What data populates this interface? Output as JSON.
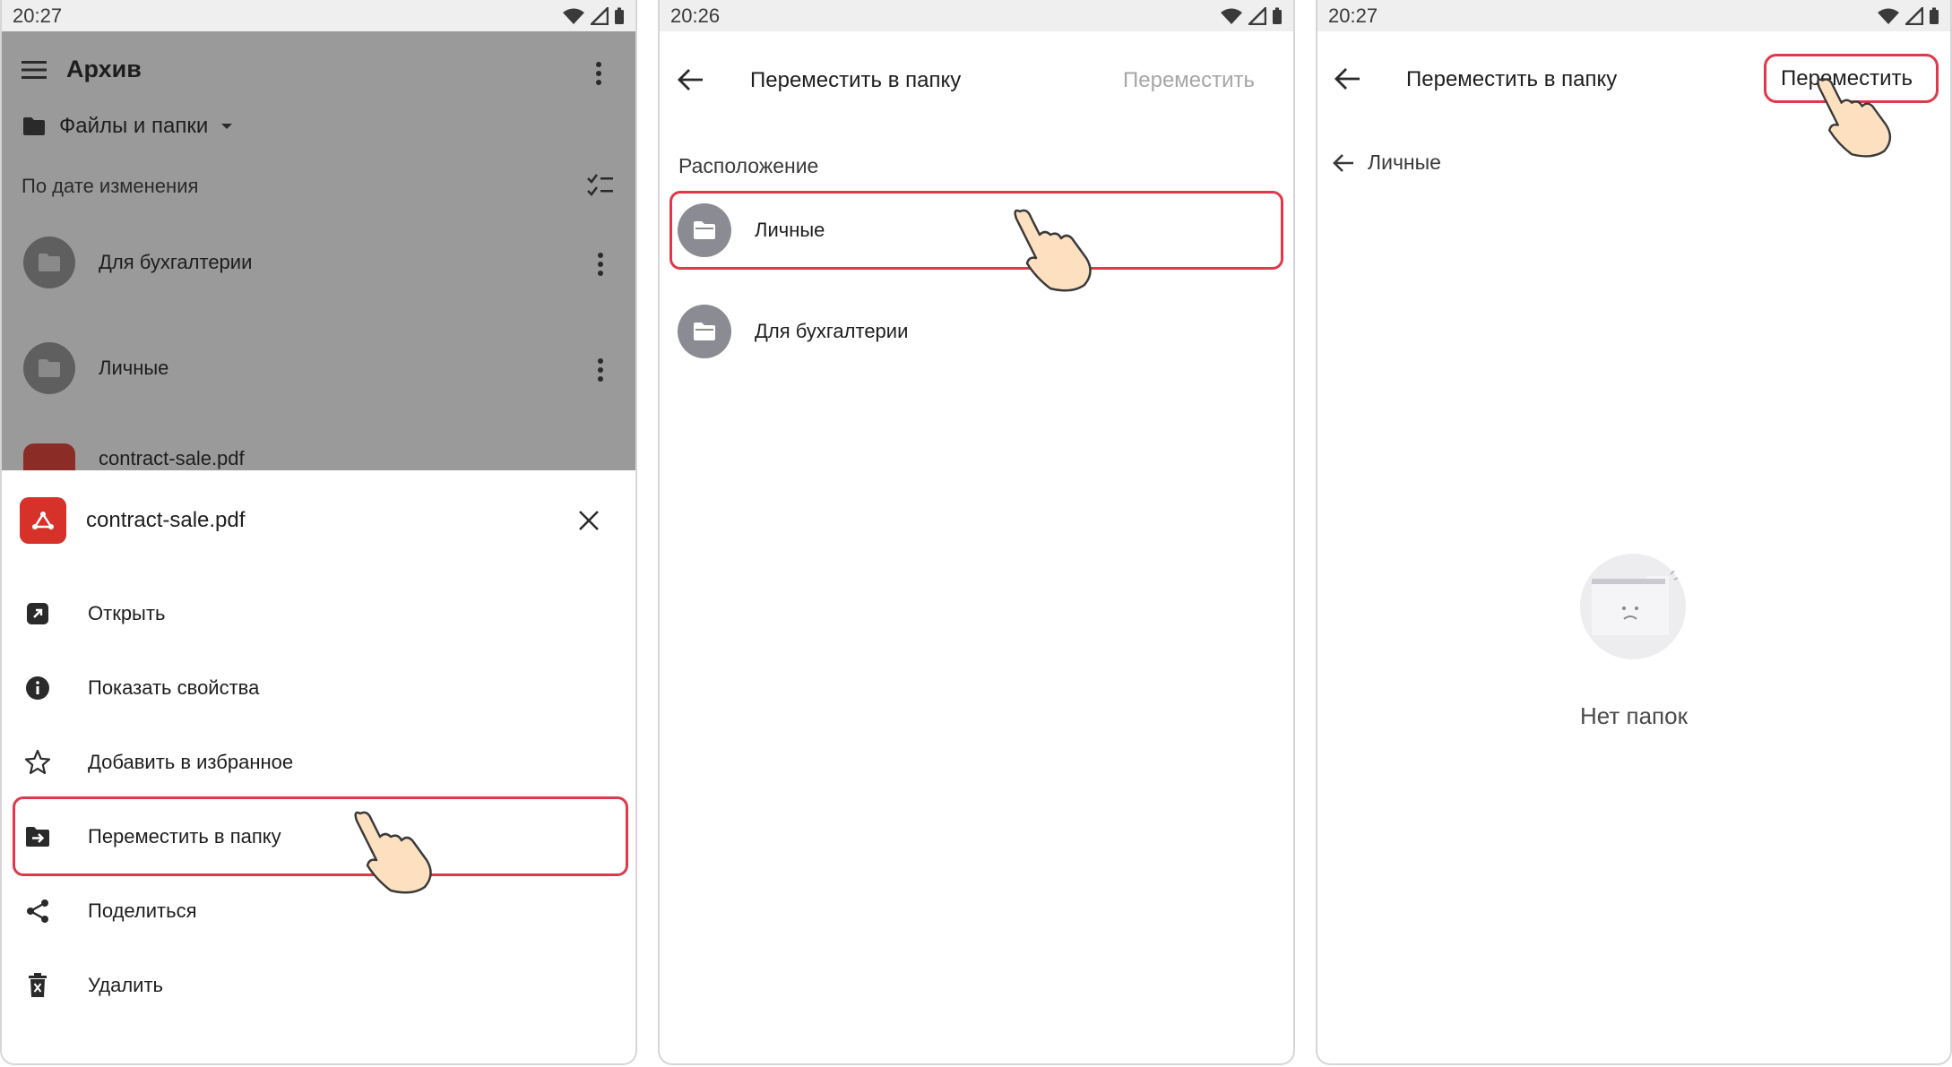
{
  "panel1": {
    "time": "20:27",
    "title": "Архив",
    "files_label": "Файлы и папки",
    "sort_label": "По дате изменения",
    "list": [
      {
        "label": "Для бухгалтерии"
      },
      {
        "label": "Личные"
      },
      {
        "label": "contract-sale.pdf"
      }
    ],
    "sheet": {
      "filename": "contract-sale.pdf",
      "items": [
        {
          "icon": "open-external-icon",
          "label": "Открыть"
        },
        {
          "icon": "info-icon",
          "label": "Показать свойства"
        },
        {
          "icon": "star-icon",
          "label": "Добавить в избранное"
        },
        {
          "icon": "move-to-folder-icon",
          "label": "Переместить в папку"
        },
        {
          "icon": "share-icon",
          "label": "Поделиться"
        },
        {
          "icon": "trash-icon",
          "label": "Удалить"
        }
      ]
    }
  },
  "panel2": {
    "time": "20:26",
    "title": "Переместить в папку",
    "action": "Переместить",
    "section": "Расположение",
    "folders": [
      {
        "label": "Личные"
      },
      {
        "label": "Для бухгалтерии"
      }
    ]
  },
  "panel3": {
    "time": "20:27",
    "title": "Переместить в папку",
    "action": "Переместить",
    "crumb": "Личные",
    "empty": "Нет папок"
  },
  "colors": {
    "highlight": "#e0384a",
    "pdf_red": "#d7322a",
    "folder_gray": "#8b8b93",
    "disabled_text": "#a6a6a6",
    "overlay": "#9a9a9a"
  }
}
